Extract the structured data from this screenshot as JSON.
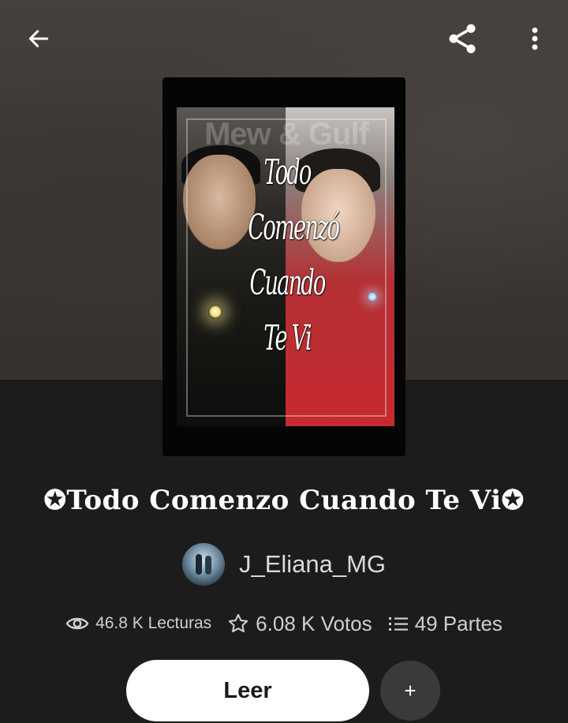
{
  "header": {
    "back_icon": "arrow-left-icon",
    "share_icon": "share-icon",
    "more_icon": "more-vertical-icon"
  },
  "cover": {
    "watermark": "Mew & Gulf",
    "title_lines": [
      "Todo",
      "Comenzó",
      "Cuando",
      "Te Vi"
    ]
  },
  "book": {
    "title": "✪Todo Comenzo Cuando Te Vi✪"
  },
  "author": {
    "name": "J_Eliana_MG"
  },
  "stats": {
    "reads": "46.8 K Lecturas",
    "votes": "6.08 K Votos",
    "parts": "49 Partes"
  },
  "actions": {
    "read_label": "Leer",
    "add_label": "+"
  },
  "colors": {
    "background": "#1c1c1c",
    "button_bg": "#ffffff",
    "add_button_bg": "#3a3a3a",
    "text_muted": "#cfcfcf"
  }
}
